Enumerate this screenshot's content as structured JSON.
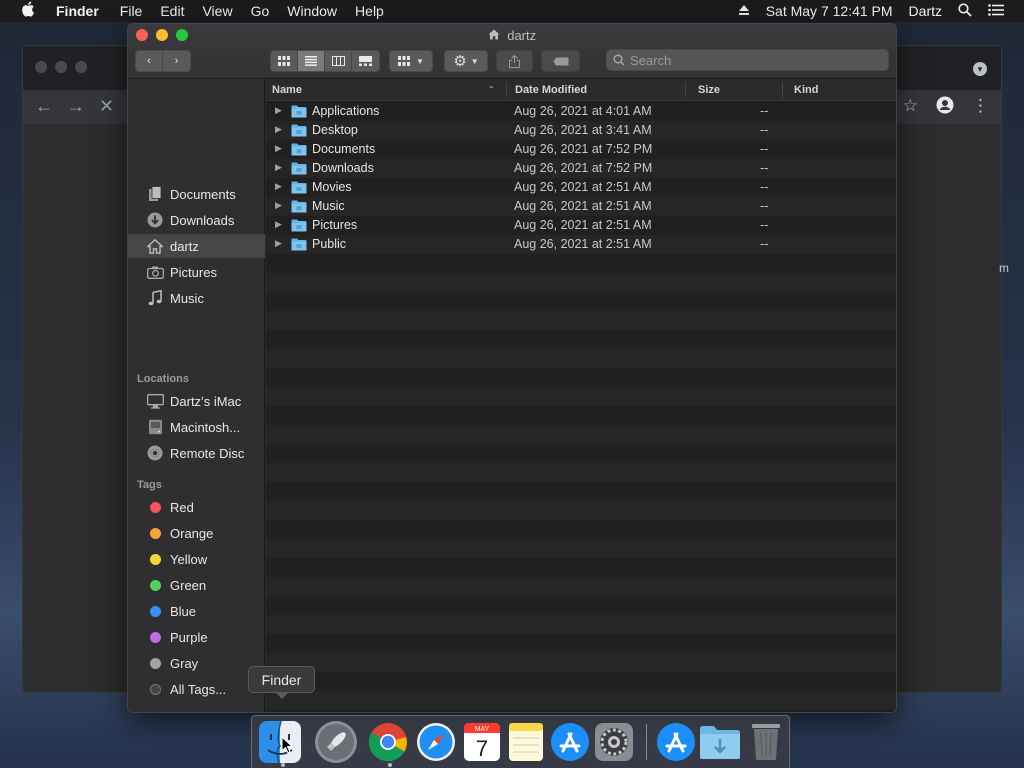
{
  "menubar": {
    "apple": "",
    "items": [
      "Finder",
      "File",
      "Edit",
      "View",
      "Go",
      "Window",
      "Help"
    ],
    "datetime": "Sat May 7  12:41 PM",
    "user": "Dartz"
  },
  "window": {
    "title": "dartz",
    "search_placeholder": "Search"
  },
  "sidebar": {
    "favorites": [
      {
        "label": "Documents",
        "icon": "documents-icon"
      },
      {
        "label": "Downloads",
        "icon": "downloads-icon"
      },
      {
        "label": "dartz",
        "icon": "home-icon"
      },
      {
        "label": "Pictures",
        "icon": "camera-icon"
      },
      {
        "label": "Music",
        "icon": "music-note-icon"
      }
    ],
    "locations_header": "Locations",
    "locations": [
      {
        "label": "Dartz’s iMac",
        "icon": "imac-icon"
      },
      {
        "label": "Macintosh...",
        "icon": "hard-drive-icon"
      },
      {
        "label": "Remote Disc",
        "icon": "disc-icon"
      }
    ],
    "tags_header": "Tags",
    "tags": [
      {
        "label": "Red",
        "color": "#f0565c"
      },
      {
        "label": "Orange",
        "color": "#f6a43a"
      },
      {
        "label": "Yellow",
        "color": "#f5d63c"
      },
      {
        "label": "Green",
        "color": "#55cf5c"
      },
      {
        "label": "Blue",
        "color": "#3c8df5"
      },
      {
        "label": "Purple",
        "color": "#c36ae5"
      },
      {
        "label": "Gray",
        "color": "#a3a3a3"
      }
    ],
    "all_tags": "All Tags..."
  },
  "columns": {
    "name": "Name",
    "date": "Date Modified",
    "size": "Size",
    "kind": "Kind"
  },
  "files": [
    {
      "name": "Applications",
      "date": "Aug 26, 2021 at 4:01 AM",
      "size": "--"
    },
    {
      "name": "Desktop",
      "date": "Aug 26, 2021 at 3:41 AM",
      "size": "--"
    },
    {
      "name": "Documents",
      "date": "Aug 26, 2021 at 7:52 PM",
      "size": "--"
    },
    {
      "name": "Downloads",
      "date": "Aug 26, 2021 at 7:52 PM",
      "size": "--"
    },
    {
      "name": "Movies",
      "date": "Aug 26, 2021 at 2:51 AM",
      "size": "--"
    },
    {
      "name": "Music",
      "date": "Aug 26, 2021 at 2:51 AM",
      "size": "--"
    },
    {
      "name": "Pictures",
      "date": "Aug 26, 2021 at 2:51 AM",
      "size": "--"
    },
    {
      "name": "Public",
      "date": "Aug 26, 2021 at 2:51 AM",
      "size": "--"
    }
  ],
  "tooltip": "Finder",
  "calendar": {
    "month": "MAY",
    "day": "7"
  },
  "bg_browser_text": "m",
  "colors": {
    "folder": "#5fb3e8",
    "selected": "#464648"
  }
}
